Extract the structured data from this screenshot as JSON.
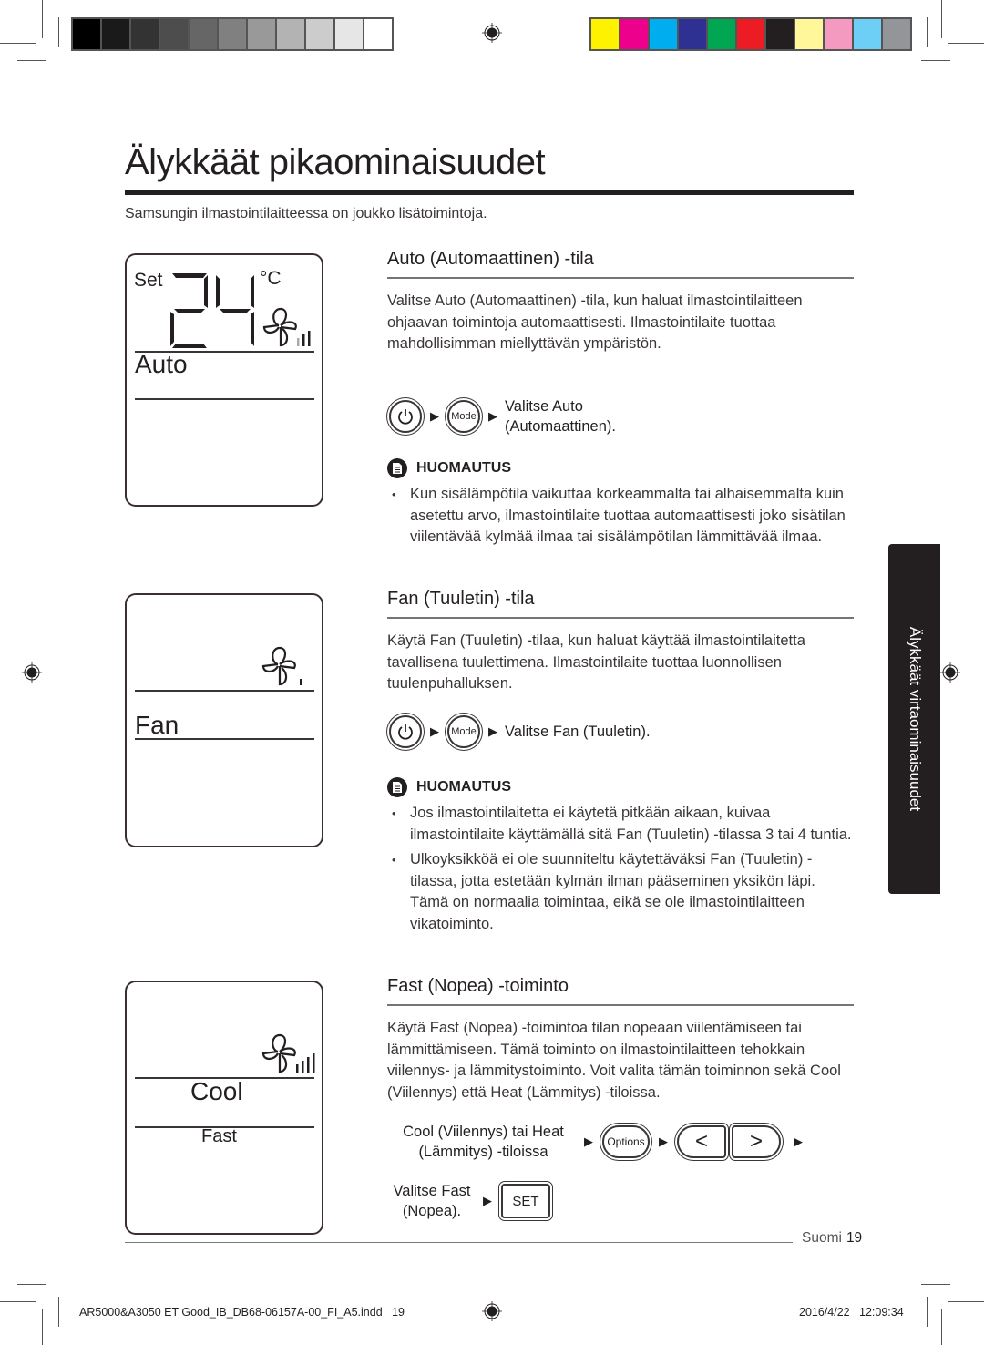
{
  "printer_marks": {
    "gray_swatches": [
      "#000000",
      "#1a1a1a",
      "#333333",
      "#4d4d4d",
      "#666666",
      "#808080",
      "#999999",
      "#b3b3b3",
      "#cccccc",
      "#e6e6e6",
      "#ffffff"
    ],
    "color_swatches": [
      "#fff200",
      "#ec008c",
      "#00aeef",
      "#2e3192",
      "#00a651",
      "#ed1c24",
      "#231f20",
      "#fff799",
      "#f49ac1",
      "#6dcff6",
      "#939598"
    ]
  },
  "page": {
    "title": "Älykkäät pikaominaisuudet",
    "intro": "Samsungin ilmastointilaitteessa on joukko lisätoimintoja.",
    "side_tab": "Älykkäät virtaominaisuudet"
  },
  "lcd_auto": {
    "set_label": "Set",
    "temperature": "24",
    "unit": "°C",
    "mode": "Auto",
    "fan_icon": "fan-icon",
    "fan_level": 2
  },
  "lcd_fan": {
    "mode": "Fan",
    "fan_icon": "fan-icon",
    "fan_level": 1
  },
  "lcd_cool": {
    "mode": "Cool",
    "function": "Fast",
    "fan_icon": "fan-icon",
    "fan_level": 4
  },
  "sections": {
    "auto": {
      "heading": "Auto (Automaattinen) -tila",
      "body": "Valitse Auto (Automaattinen) -tila, kun haluat ilmastointilaitteen ohjaavan toimintoja automaattisesti. Ilmastointilaite tuottaa mahdollisimman miellyttävän ympäristön.",
      "step": {
        "power_icon": "power-icon",
        "mode_label": "Mode",
        "result_line1": "Valitse Auto",
        "result_line2": "(Automaattinen)."
      },
      "note_heading": "HUOMAUTUS",
      "notes": [
        "Kun sisälämpötila vaikuttaa korkeammalta tai alhaisemmalta kuin asetettu arvo, ilmastointilaite tuottaa automaattisesti joko sisätilan viilentävää kylmää ilmaa tai sisälämpötilan lämmittävää ilmaa."
      ]
    },
    "fan": {
      "heading": "Fan (Tuuletin) -tila",
      "body": "Käytä Fan (Tuuletin) -tilaa, kun haluat käyttää ilmastointilaitetta tavallisena tuulettimena. Ilmastointilaite tuottaa luonnollisen tuulenpuhalluksen.",
      "step": {
        "power_icon": "power-icon",
        "mode_label": "Mode",
        "result": "Valitse Fan (Tuuletin)."
      },
      "note_heading": "HUOMAUTUS",
      "notes": [
        "Jos ilmastointilaitetta ei käytetä pitkään aikaan, kuivaa ilmastointilaite käyttämällä sitä Fan (Tuuletin) -tilassa 3 tai 4 tuntia.",
        "Ulkoyksikköä ei ole suunniteltu käytettäväksi Fan (Tuuletin) -tilassa, jotta estetään kylmän ilman pääseminen yksikön läpi. Tämä on normaalia toimintaa, eikä se ole ilmastointilaitteen vikatoiminto."
      ]
    },
    "fast": {
      "heading": "Fast (Nopea) -toiminto",
      "body": "Käytä Fast (Nopea) -toimintoa tilan nopeaan viilentämiseen tai lämmittämiseen. Tämä toiminto on ilmastointilaitteen tehokkain viilennys- ja lämmitystoiminto. Voit valita tämän toiminnon sekä Cool (Viilennys) että Heat (Lämmitys) -tiloissa.",
      "step1": {
        "condition_line1": "Cool (Viilennys) tai Heat",
        "condition_line2": "(Lämmitys) -tiloissa",
        "options_label": "Options",
        "left_label": "<",
        "right_label": ">"
      },
      "step2": {
        "line1": "Valitse Fast",
        "line2": "(Nopea).",
        "set_label": "SET"
      }
    }
  },
  "footer": {
    "language": "Suomi",
    "page_number": "19",
    "slug_file": "AR5000&A3050 ET Good_IB_DB68-06157A-00_FI_A5.indd   19",
    "slug_date": "2016/4/22   12:09:34"
  }
}
